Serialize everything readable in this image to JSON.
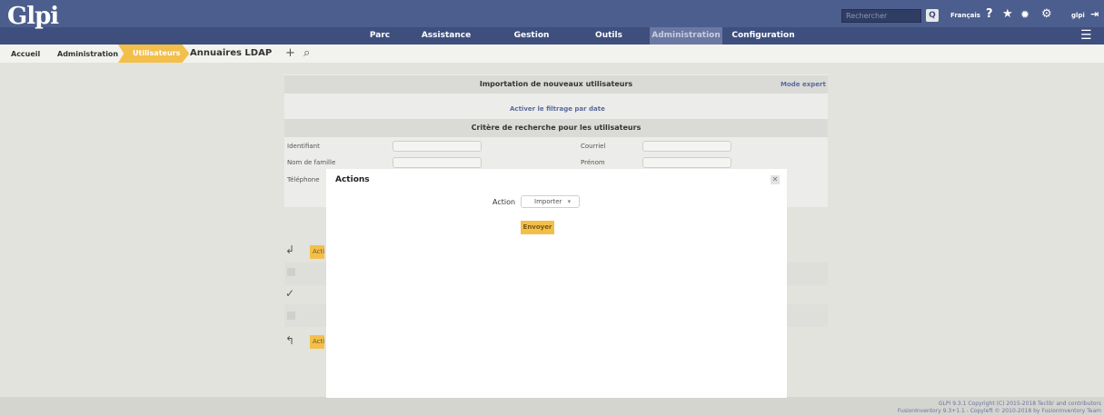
{
  "header": {
    "logo": "Glpi",
    "search_placeholder": "Rechercher",
    "search_button": "Q",
    "language": "Français",
    "user": "glpi",
    "menu": [
      {
        "label": "Parc"
      },
      {
        "label": "Assistance"
      },
      {
        "label": "Gestion"
      },
      {
        "label": "Outils"
      },
      {
        "label": "Administration",
        "active": true
      },
      {
        "label": "Configuration"
      }
    ]
  },
  "breadcrumb": {
    "items": [
      "Accueil",
      "Administration",
      "Utilisateurs"
    ],
    "title": "Annuaires LDAP"
  },
  "form": {
    "import_title": "Importation de nouveaux utilisateurs",
    "expert_mode": "Mode expert",
    "date_filter": "Activer le filtrage par date",
    "criteria_title": "Critère de recherche pour les utilisateurs",
    "fields": {
      "identifiant": "Identifiant",
      "courriel": "Courriel",
      "nom": "Nom de famille",
      "prenom": "Prénom",
      "telephone": "Téléphone"
    },
    "actions_short": "Acti"
  },
  "dialog": {
    "title": "Actions",
    "action_label": "Action",
    "action_value": "Importer",
    "submit": "Envoyer"
  },
  "footer": {
    "line1": "GLPI 9.3.1 Copyright (C) 2015-2018 Teclib' and contributors",
    "line2": "FusionInventory 9.3+1.1 - Copyleft © 2010-2018 by FusionInventory Team"
  }
}
